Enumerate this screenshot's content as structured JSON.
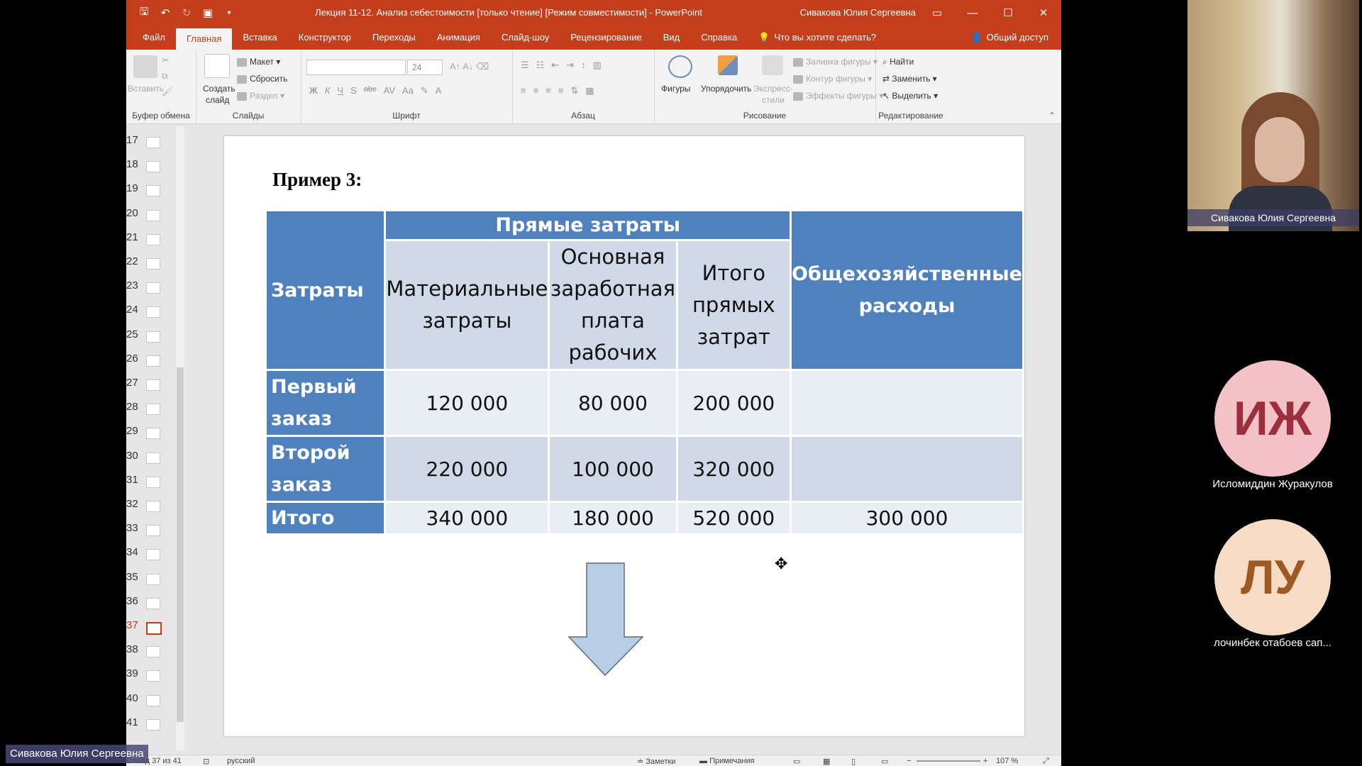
{
  "window": {
    "title": "Лекция 11-12. Анализ себестоимости [только чтение] [Режим совместимости]  -  PowerPoint",
    "user": "Сивакова Юлия Сергеевна"
  },
  "tabs": [
    "Файл",
    "Главная",
    "Вставка",
    "Конструктор",
    "Переходы",
    "Анимация",
    "Слайд-шоу",
    "Рецензирование",
    "Вид",
    "Справка"
  ],
  "tellme": "Что вы хотите сделать?",
  "share": "Общий доступ",
  "ribbon": {
    "clipboard": {
      "paste": "Вставить",
      "label": "Буфер обмена"
    },
    "slides": {
      "new_slide_1": "Создать",
      "new_slide_2": "слайд",
      "layout": "Макет",
      "reset": "Сбросить",
      "section": "Раздел",
      "label": "Слайды"
    },
    "font": {
      "size": "24",
      "label": "Шрифт",
      "bold": "Ж",
      "italic": "К",
      "underline": "Ч",
      "shadow": "S",
      "strike": "abc"
    },
    "paragraph": {
      "label": "Абзац"
    },
    "drawing": {
      "shapes": "Фигуры",
      "arrange": "Упорядочить",
      "styles_1": "Экспресс-",
      "styles_2": "стили",
      "fill": "Заливка фигуры",
      "outline": "Контур фигуры",
      "effects": "Эффекты фигуры",
      "label": "Рисование"
    },
    "editing": {
      "find": "Найти",
      "replace": "Заменить",
      "select": "Выделить",
      "label": "Редактирование"
    }
  },
  "thumbnails": {
    "numbers": [
      "17",
      "18",
      "19",
      "20",
      "21",
      "22",
      "23",
      "24",
      "25",
      "26",
      "27",
      "28",
      "29",
      "30",
      "31",
      "32",
      "33",
      "34",
      "35",
      "36",
      "37",
      "38",
      "39",
      "40",
      "41"
    ],
    "active": "37"
  },
  "slide": {
    "heading": "Пример 3:",
    "table": {
      "corner": "Затраты",
      "group_header": "Прямые затраты",
      "sub_headers": [
        "Материальные затраты",
        "Основная заработная плата рабочих",
        "Итого прямых затрат"
      ],
      "overhead_header": "Общехозяйственные расходы",
      "rows": [
        {
          "label": "Первый заказ",
          "values": [
            "120 000",
            "80 000",
            "200 000",
            ""
          ]
        },
        {
          "label": "Второй заказ",
          "values": [
            "220 000",
            "100 000",
            "320 000",
            ""
          ]
        },
        {
          "label": "Итого",
          "values": [
            "340 000",
            "180 000",
            "520 000",
            "300 000"
          ]
        }
      ]
    }
  },
  "statusbar": {
    "slide_counter": "Слайд 37 из 41",
    "language": "русский",
    "notes": "Заметки",
    "comments": "Примечания",
    "zoom": "107 %"
  },
  "call": {
    "presenter": "Сивакова Юлия Сергеевна",
    "participants": [
      {
        "initials": "ИЖ",
        "name": "Исломиддин Журакулов",
        "color": "#f3c2c7",
        "text_color": "#9c2f3b"
      },
      {
        "initials": "ЛУ",
        "name": "лочинбек отабоев сап...",
        "color": "#f7dcc5",
        "text_color": "#9c5a22"
      }
    ],
    "bottom_label": "Сивакова Юлия Сергеевна"
  }
}
